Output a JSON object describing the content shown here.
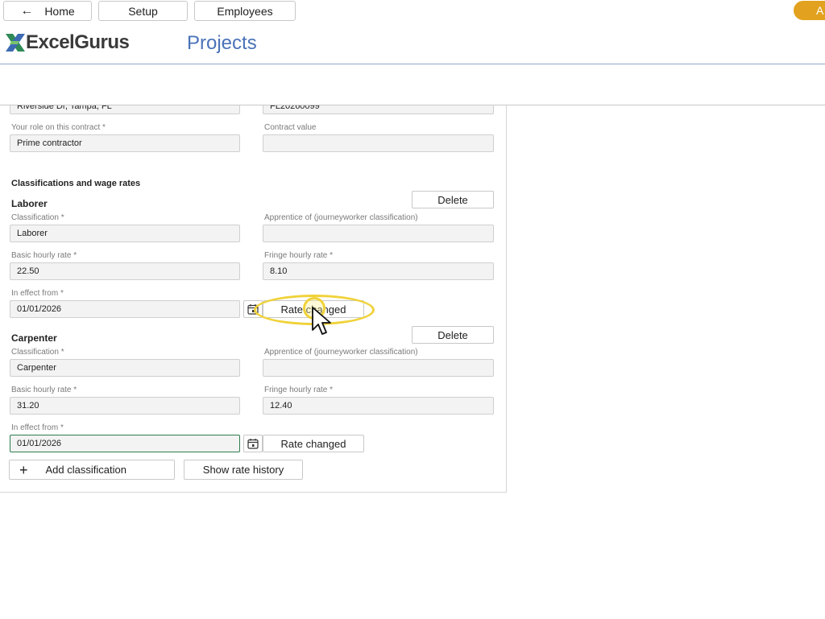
{
  "nav": {
    "home_label": "Home",
    "setup_label": "Setup",
    "employees_label": "Employees",
    "pill_label": "A"
  },
  "brand": {
    "logo_text": "ExcelGurus",
    "page_title": "Projects"
  },
  "contract": {
    "address_value": "Riverside Dr, Tampa, FL",
    "contract_no_value": "FL20260099",
    "role_label": "Your role on this contract *",
    "role_value": "Prime contractor",
    "contract_value_label": "Contract value",
    "contract_value_value": ""
  },
  "classifications": {
    "section_title": "Classifications and wage rates",
    "items": [
      {
        "title": "Laborer",
        "delete_label": "Delete",
        "classification_label": "Classification *",
        "classification_value": "Laborer",
        "apprentice_label": "Apprentice of (journeyworker classification)",
        "apprentice_value": "",
        "basic_label": "Basic hourly rate *",
        "basic_value": "22.50",
        "fringe_label": "Fringe hourly rate *",
        "fringe_value": "8.10",
        "effect_label": "In effect from *",
        "effect_value": "01/01/2026",
        "rate_changed_label": "Rate changed"
      },
      {
        "title": "Carpenter",
        "delete_label": "Delete",
        "classification_label": "Classification *",
        "classification_value": "Carpenter",
        "apprentice_label": "Apprentice of (journeyworker classification)",
        "apprentice_value": "",
        "basic_label": "Basic hourly rate *",
        "basic_value": "31.20",
        "fringe_label": "Fringe hourly rate *",
        "fringe_value": "12.40",
        "effect_label": "In effect from *",
        "effect_value": "01/01/2026",
        "rate_changed_label": "Rate changed"
      }
    ],
    "add_label": "Add classification",
    "history_label": "Show rate history"
  },
  "icons": {
    "back": "arrow-left-icon",
    "calendar": "calendar-icon",
    "plus": "plus-icon"
  },
  "colors": {
    "accent_pill": "#e2a21f",
    "title_blue": "#4a72b8",
    "highlight": "#f0d23a",
    "active_border": "#2e7d4f"
  }
}
